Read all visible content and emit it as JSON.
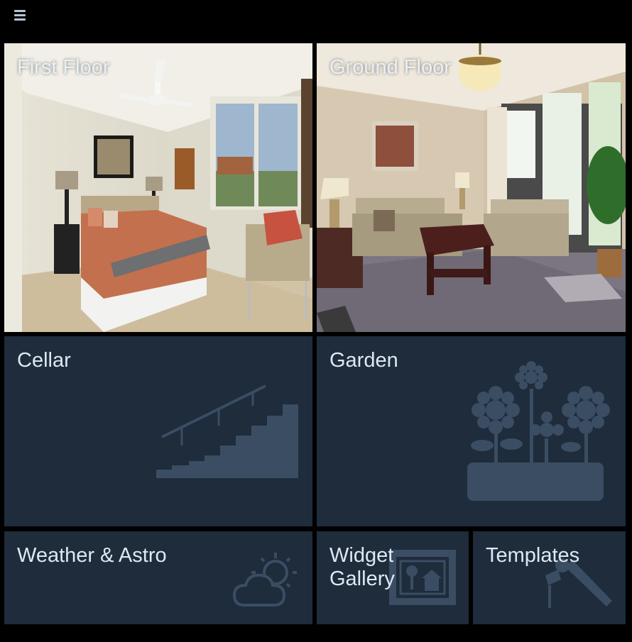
{
  "header": {
    "menu_icon": "hamburger-menu-icon"
  },
  "tiles": [
    {
      "label": "First Floor",
      "icon": "bedroom-photo"
    },
    {
      "label": "Ground Floor",
      "icon": "living-room-photo"
    },
    {
      "label": "Cellar",
      "icon": "stairs-icon"
    },
    {
      "label": "Garden",
      "icon": "flowers-icon"
    },
    {
      "label": "Weather & Astro",
      "icon": "cloud-sun-icon"
    },
    {
      "label": "Widget\nGallery",
      "icon": "picture-frame-icon"
    },
    {
      "label": "Templates",
      "icon": "tools-icon"
    }
  ],
  "colors": {
    "tile_bg": "#1e2c3c",
    "icon_fg": "#3a4d63",
    "text": "#dfe8f2"
  }
}
